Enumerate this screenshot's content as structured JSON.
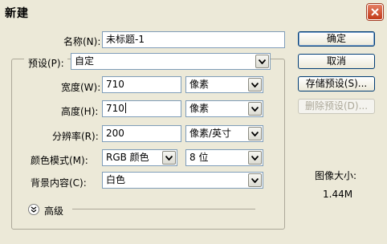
{
  "window": {
    "title": "新建"
  },
  "fields": {
    "name": {
      "label": "名称(N):",
      "value": "未标题-1"
    },
    "preset": {
      "label": "预设(P):",
      "value": "自定"
    },
    "width": {
      "label": "宽度(W):",
      "value": "710",
      "unit": "像素"
    },
    "height": {
      "label": "高度(H):",
      "value": "710",
      "unit": "像素"
    },
    "resolution": {
      "label": "分辨率(R):",
      "value": "200",
      "unit": "像素/英寸"
    },
    "color_mode": {
      "label": "颜色模式(M):",
      "value": "RGB 颜色",
      "depth": "8 位"
    },
    "background": {
      "label": "背景内容(C):",
      "value": "白色"
    }
  },
  "advanced": {
    "label": "高级"
  },
  "buttons": {
    "ok": "确定",
    "cancel": "取消",
    "save_preset": "存储预设(S)...",
    "delete_preset": "删除预设(D)..."
  },
  "image_size": {
    "label": "图像大小:",
    "value": "1.44M"
  },
  "icons": {
    "close": "close-icon",
    "dropdown": "chevron-down-icon",
    "expand": "expand-chevron-icon"
  },
  "colors": {
    "dialog_bg": "#ece9d8",
    "border": "#7f9db9",
    "close_red": "#c13a1a"
  }
}
